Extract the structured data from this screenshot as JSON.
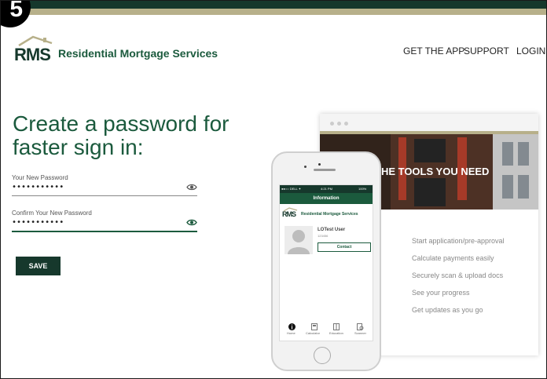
{
  "step": "5",
  "brand": {
    "logo": "RMS",
    "name": "Residential Mortgage Services"
  },
  "nav": {
    "get_app": "GET THE APP",
    "support": "SUPPORT",
    "login": "LOGIN"
  },
  "form": {
    "headline_line1": "Create a password for",
    "headline_line2": "faster sign in:",
    "new_password_label": "Your New Password",
    "new_password_value": "•••••••••••",
    "confirm_label": "Confirm Your New Password",
    "confirm_value": "•••••••••••",
    "save_label": "SAVE"
  },
  "promo": {
    "hero_title": "THE TOOLS YOU NEED",
    "features": [
      "Start application/pre-approval",
      "Calculate payments easily",
      "Securely scan & upload docs",
      "See your progress",
      "Get updates as you go"
    ]
  },
  "phone": {
    "status_carrier": "●●○○ DELL ✦",
    "status_time": "4:21 PM",
    "status_battery": "100%",
    "screen_title": "Information",
    "logo": "RMS",
    "brand_name": "Residential Mortgage Services",
    "user_name": "LOTest User",
    "user_id": "123456",
    "contact_label": "Contact",
    "tabs": [
      "Home",
      "Calculator",
      "Education",
      "Scanner"
    ]
  },
  "colors": {
    "primary": "#16382c",
    "brand_green": "#1b5a3d",
    "accent_gold": "#b7b08a"
  }
}
